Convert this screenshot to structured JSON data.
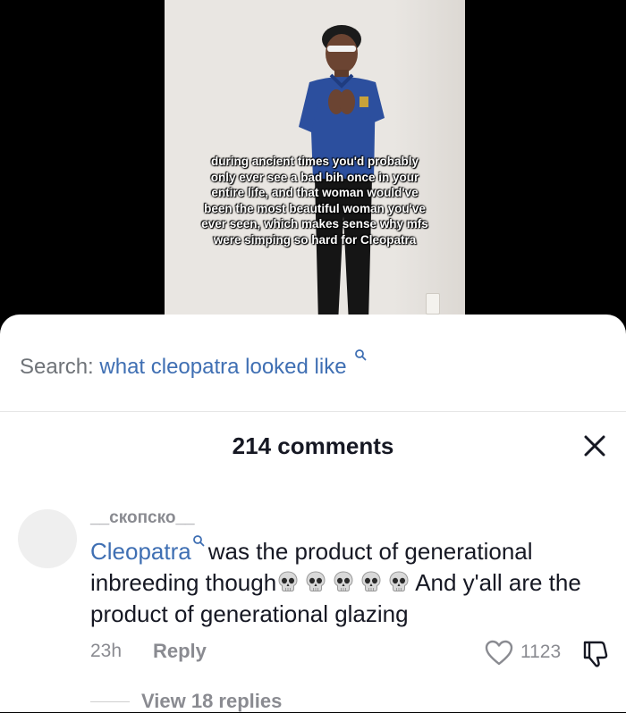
{
  "video": {
    "caption": "during ancient times you'd probably only ever see a bad bih once in your entire life, and that woman would've been the most beautiful woman you've ever seen, which makes sense why mfs were simping so hard for Cleopatra"
  },
  "search": {
    "prefix": "Search:",
    "term": "what cleopatra looked like",
    "icon": "search-icon"
  },
  "comments_header": {
    "count_label": "214 comments",
    "close_icon": "close-icon"
  },
  "comment": {
    "username": "__скопско__",
    "mention": "Cleopatra",
    "text_part1": "was the product of generational inbreeding though",
    "emoji": "skull",
    "emoji_count": 5,
    "text_part2": "And y'all are the product of generational glazing",
    "time": "23h",
    "reply_label": "Reply",
    "like_count": "1123"
  },
  "replies": {
    "label": "View 18 replies"
  },
  "colors": {
    "link": "#3f6fb3",
    "muted": "#8a8b91",
    "text": "#161823"
  }
}
